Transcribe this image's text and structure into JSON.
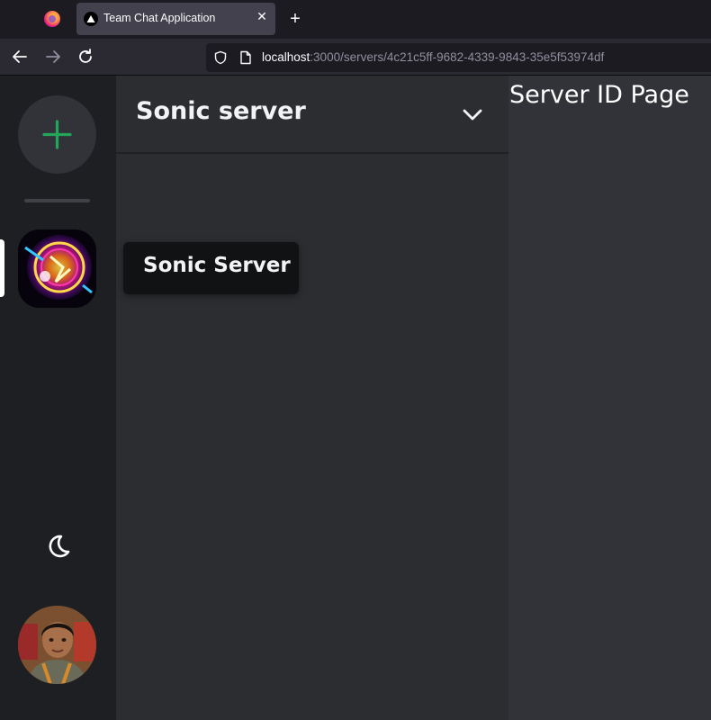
{
  "browser": {
    "tab_title": "Team Chat Application",
    "tab_close": "✕",
    "new_tab": "+",
    "url_host": "localhost",
    "url_rest": ":3000/servers/4c21c5ff-9682-4339-9843-35e5f53974df"
  },
  "rail": {
    "add_server_icon": "plus-icon",
    "theme_icon": "moon-icon",
    "accent_color": "#23a55a"
  },
  "sidebar": {
    "server_name": "Sonic server"
  },
  "tooltip": {
    "text": "Sonic Server"
  },
  "main": {
    "title": "Server ID Page"
  }
}
